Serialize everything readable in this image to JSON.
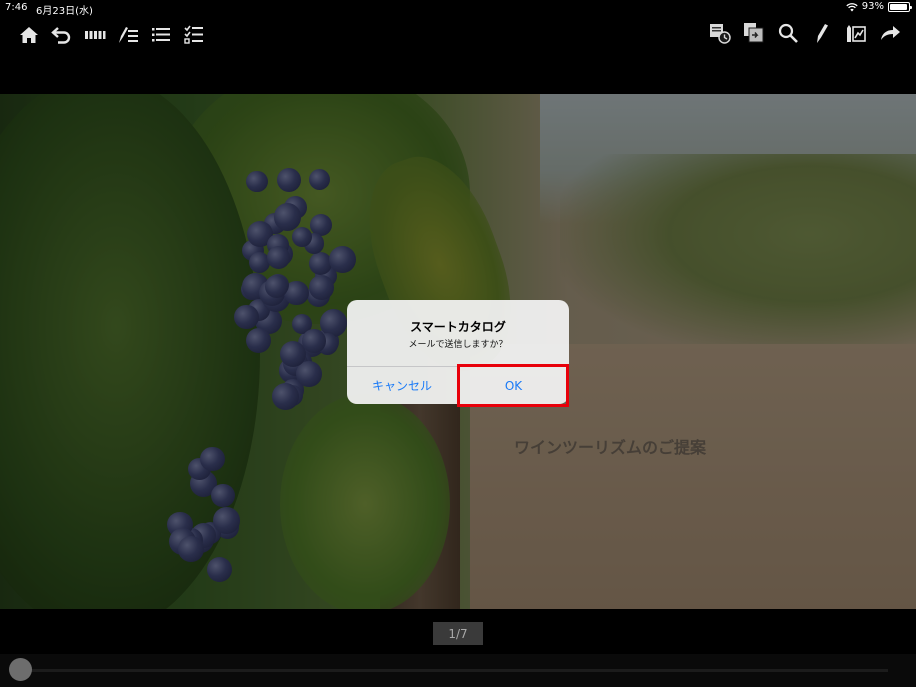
{
  "status_bar": {
    "time": "7:46",
    "date": "6月23日(水)",
    "battery": "93%",
    "battery_level": 0.93
  },
  "toolbar": {
    "left_icons": [
      "home-icon",
      "back-icon",
      "page-strip-icon",
      "pen-list-icon",
      "list-icon",
      "checklist-icon"
    ],
    "right_icons": [
      "history-icon",
      "send-icon",
      "search-icon",
      "pen-icon",
      "edit-chart-icon",
      "share-icon"
    ]
  },
  "slide": {
    "title": "ワインツーリズムのご提案"
  },
  "dialog": {
    "title": "スマートカタログ",
    "message": "メールで送信しますか？",
    "cancel_label": "キャンセル",
    "ok_label": "OK",
    "accent_color": "#1a7af7",
    "highlight_color": "#e8000a"
  },
  "pager": {
    "label": "1/7",
    "position": 0.0
  }
}
